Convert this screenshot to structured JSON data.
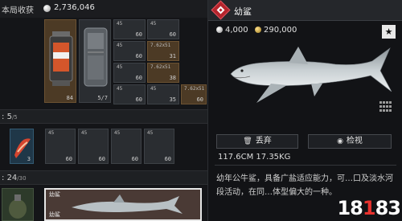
{
  "inventory": {
    "top_label": "本局收获",
    "top_value": "2,736,046",
    "items": [
      {
        "num": "84"
      },
      {
        "num": "5/7"
      },
      {
        "tl": "45",
        "num": "60"
      },
      {
        "tl": "45",
        "num": "60"
      },
      {
        "tl": "45",
        "num": "60"
      },
      {
        "tl": "45",
        "num": "60"
      },
      {
        "tl": "7.62x51",
        "num": "31"
      },
      {
        "tl": "45",
        "num": "60"
      },
      {
        "tl": "7.62x51",
        "num": "38"
      },
      {
        "tl": "45",
        "num": "35"
      },
      {
        "tl": "7.62x51",
        "num": "60"
      }
    ],
    "section1": {
      "prefix": ":",
      "count": "5",
      "max": "5"
    },
    "row2": [
      {
        "num": "3"
      },
      {
        "tl": "45",
        "num": "60"
      },
      {
        "tl": "45",
        "num": "60"
      },
      {
        "tl": "45",
        "num": "60"
      },
      {
        "tl": "45",
        "num": "60"
      }
    ],
    "section2": {
      "prefix": ":",
      "count": "24",
      "max": "30"
    },
    "bottom_label_1": "幼鲨",
    "bottom_label_2": "幼鲨"
  },
  "detail": {
    "title": "幼鲨",
    "price_silver": "4,000",
    "price_gold": "290,000",
    "discard_label": "丢弃",
    "inspect_label": "检视",
    "dimensions": "117.6CM 17.35KG",
    "description": "幼年公牛鲨，具备广盐适应能力，可…口及淡水河段活动，在同…体型偏大的一种。"
  },
  "watermark": {
    "a": "18",
    "b": "1",
    "c": "83"
  },
  "colors": {
    "accent_red": "#b5242c",
    "gold": "#c9a23a",
    "silver": "#bdbdbd"
  }
}
